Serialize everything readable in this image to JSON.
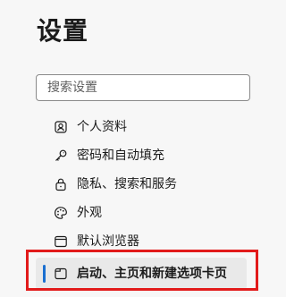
{
  "header": {
    "title": "设置"
  },
  "search": {
    "placeholder": "搜索设置",
    "value": ""
  },
  "sidebar": {
    "items": [
      {
        "label": "个人资料",
        "icon": "profile-icon",
        "active": false
      },
      {
        "label": "密码和自动填充",
        "icon": "key-icon",
        "active": false
      },
      {
        "label": "隐私、搜索和服务",
        "icon": "lock-icon",
        "active": false
      },
      {
        "label": "外观",
        "icon": "palette-icon",
        "active": false
      },
      {
        "label": "默认浏览器",
        "icon": "browser-window-icon",
        "active": false
      },
      {
        "label": "启动、主页和新建选项卡页",
        "icon": "tab-page-icon",
        "active": true
      }
    ]
  },
  "colors": {
    "active_indicator": "#1a6fd0",
    "highlight_box": "#e21b1b",
    "active_background": "#e9e9e9"
  }
}
